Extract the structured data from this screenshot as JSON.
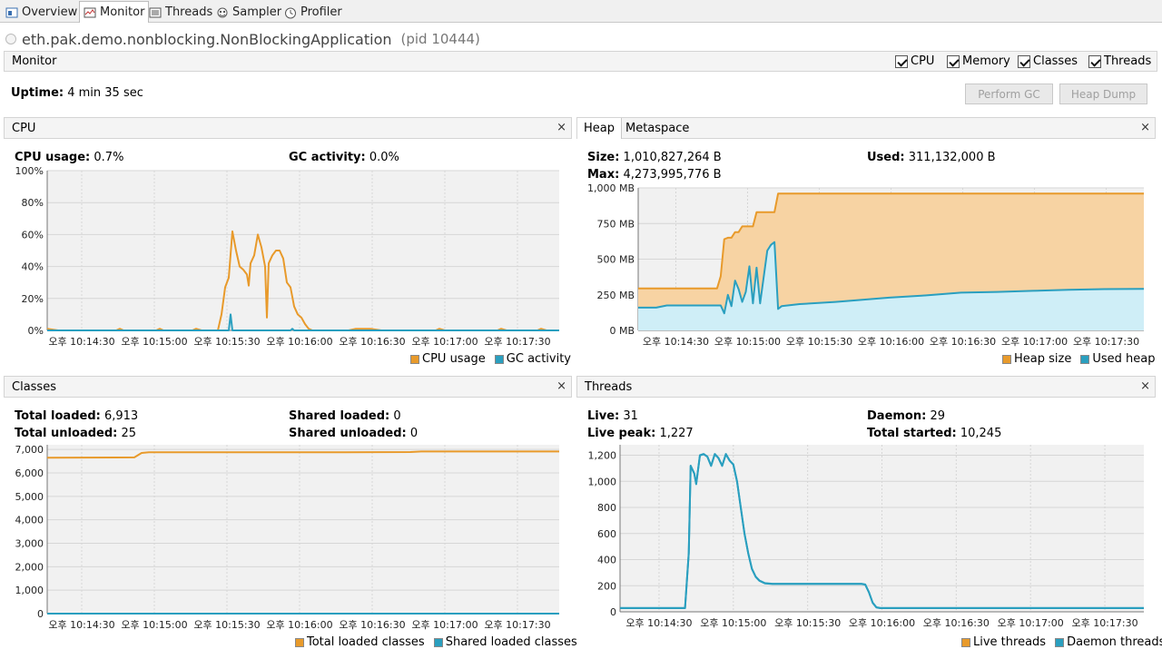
{
  "tabs": [
    {
      "label": "Overview",
      "icon": "overview-icon"
    },
    {
      "label": "Monitor",
      "icon": "monitor-icon",
      "active": true
    },
    {
      "label": "Threads",
      "icon": "threads-icon"
    },
    {
      "label": "Sampler",
      "icon": "sampler-icon"
    },
    {
      "label": "Profiler",
      "icon": "profiler-icon"
    }
  ],
  "app": {
    "name": "eth.pak.demo.nonblocking.NonBlockingApplication",
    "pid": "(pid 10444)"
  },
  "monitor_bar": {
    "label": "Monitor",
    "checkboxes": [
      {
        "label": "CPU",
        "checked": true
      },
      {
        "label": "Memory",
        "checked": true
      },
      {
        "label": "Classes",
        "checked": true
      },
      {
        "label": "Threads",
        "checked": true
      }
    ]
  },
  "uptime": {
    "label": "Uptime:",
    "value": "4 min 35 sec"
  },
  "buttons": {
    "perform_gc": "Perform GC",
    "heap_dump": "Heap Dump"
  },
  "cpu_panel": {
    "title": "CPU",
    "close": "×",
    "cpu_usage_label": "CPU usage:",
    "cpu_usage_value": "0.7%",
    "gc_label": "GC activity:",
    "gc_value": "0.0%",
    "legend": [
      "CPU usage",
      "GC activity"
    ]
  },
  "memory_panel": {
    "tabs": [
      "Heap",
      "Metaspace"
    ],
    "close": "×",
    "size_label": "Size:",
    "size_value": "1,010,827,264 B",
    "max_label": "Max:",
    "max_value": "4,273,995,776 B",
    "used_label": "Used:",
    "used_value": "311,132,000 B",
    "legend": [
      "Heap size",
      "Used heap"
    ]
  },
  "classes_panel": {
    "title": "Classes",
    "close": "×",
    "total_loaded_label": "Total loaded:",
    "total_loaded_value": "6,913",
    "total_unloaded_label": "Total unloaded:",
    "total_unloaded_value": "25",
    "shared_loaded_label": "Shared loaded:",
    "shared_loaded_value": "0",
    "shared_unloaded_label": "Shared unloaded:",
    "shared_unloaded_value": "0",
    "legend": [
      "Total loaded classes",
      "Shared loaded classes"
    ]
  },
  "threads_panel": {
    "title": "Threads",
    "close": "×",
    "live_label": "Live:",
    "live_value": "31",
    "live_peak_label": "Live peak:",
    "live_peak_value": "1,227",
    "daemon_label": "Daemon:",
    "daemon_value": "29",
    "total_started_label": "Total started:",
    "total_started_value": "10,245",
    "legend": [
      "Live threads",
      "Daemon threads"
    ]
  },
  "colors": {
    "orange": "#e89a2b",
    "teal": "#2a9fbf",
    "orange_fill": "#f7d3a3",
    "teal_fill": "#cfeef7",
    "grid": "#d6d6d6",
    "plot_bg": "#f1f1f1"
  },
  "chart_data": [
    {
      "type": "line",
      "title": "CPU",
      "x_ticks": [
        "오후 10:14:30",
        "오후 10:15:00",
        "오후 10:15:30",
        "오후 10:16:00",
        "오후 10:16:30",
        "오후 10:17:00",
        "오후 10:17:30"
      ],
      "y_ticks": [
        "100%",
        "80%",
        "60%",
        "40%",
        "20%",
        "0%"
      ],
      "ylim": [
        0,
        100
      ],
      "x_range_sec": [
        0,
        282
      ],
      "series": [
        {
          "name": "CPU usage",
          "color": "#e89a2b",
          "points": [
            [
              0,
              1
            ],
            [
              6,
              0
            ],
            [
              22,
              0
            ],
            [
              38,
              0
            ],
            [
              40,
              1
            ],
            [
              42,
              0
            ],
            [
              60,
              0
            ],
            [
              62,
              1
            ],
            [
              64,
              0
            ],
            [
              80,
              0
            ],
            [
              82,
              1
            ],
            [
              85,
              0
            ],
            [
              94,
              0
            ],
            [
              96,
              10
            ],
            [
              98,
              27
            ],
            [
              100,
              33
            ],
            [
              102,
              62
            ],
            [
              104,
              50
            ],
            [
              106,
              40
            ],
            [
              108,
              38
            ],
            [
              110,
              35
            ],
            [
              111,
              28
            ],
            [
              112,
              42
            ],
            [
              114,
              47
            ],
            [
              116,
              60
            ],
            [
              118,
              52
            ],
            [
              120,
              40
            ],
            [
              121,
              8
            ],
            [
              122,
              42
            ],
            [
              124,
              47
            ],
            [
              126,
              50
            ],
            [
              128,
              50
            ],
            [
              130,
              45
            ],
            [
              132,
              30
            ],
            [
              134,
              27
            ],
            [
              136,
              15
            ],
            [
              138,
              10
            ],
            [
              140,
              8
            ],
            [
              142,
              4
            ],
            [
              144,
              1
            ],
            [
              146,
              0
            ],
            [
              166,
              0
            ],
            [
              170,
              1
            ],
            [
              178,
              1
            ],
            [
              184,
              0
            ],
            [
              214,
              0
            ],
            [
              216,
              1
            ],
            [
              219,
              0
            ],
            [
              248,
              0
            ],
            [
              250,
              1
            ],
            [
              253,
              0
            ],
            [
              270,
              0
            ],
            [
              272,
              1
            ],
            [
              275,
              0
            ],
            [
              282,
              0
            ]
          ]
        },
        {
          "name": "GC activity",
          "color": "#2a9fbf",
          "points": [
            [
              0,
              0
            ],
            [
              100,
              0
            ],
            [
              101,
              10
            ],
            [
              102,
              0
            ],
            [
              134,
              0
            ],
            [
              135,
              1
            ],
            [
              136,
              0
            ],
            [
              282,
              0
            ]
          ]
        }
      ]
    },
    {
      "type": "area",
      "title": "Heap",
      "x_ticks": [
        "오후 10:14:30",
        "오후 10:15:00",
        "오후 10:15:30",
        "오후 10:16:00",
        "오후 10:16:30",
        "오후 10:17:00",
        "오후 10:17:30"
      ],
      "y_ticks": [
        "1,000 MB",
        "750 MB",
        "500 MB",
        "250 MB",
        "0 MB"
      ],
      "ylim": [
        0,
        1000
      ],
      "x_range_sec": [
        0,
        282
      ],
      "series": [
        {
          "name": "Heap size",
          "color": "#e89a2b",
          "points": [
            [
              0,
              295
            ],
            [
              44,
              295
            ],
            [
              46,
              380
            ],
            [
              48,
              640
            ],
            [
              50,
              650
            ],
            [
              52,
              650
            ],
            [
              54,
              690
            ],
            [
              56,
              690
            ],
            [
              58,
              730
            ],
            [
              60,
              730
            ],
            [
              64,
              730
            ],
            [
              66,
              830
            ],
            [
              68,
              830
            ],
            [
              76,
              830
            ],
            [
              78,
              960
            ],
            [
              80,
              960
            ],
            [
              282,
              960
            ]
          ]
        },
        {
          "name": "Used heap",
          "color": "#2a9fbf",
          "points": [
            [
              0,
              160
            ],
            [
              10,
              160
            ],
            [
              16,
              175
            ],
            [
              46,
              175
            ],
            [
              48,
              120
            ],
            [
              50,
              250
            ],
            [
              52,
              170
            ],
            [
              54,
              350
            ],
            [
              56,
              290
            ],
            [
              58,
              200
            ],
            [
              60,
              270
            ],
            [
              62,
              450
            ],
            [
              64,
              190
            ],
            [
              66,
              440
            ],
            [
              68,
              190
            ],
            [
              72,
              560
            ],
            [
              74,
              600
            ],
            [
              76,
              620
            ],
            [
              78,
              150
            ],
            [
              80,
              170
            ],
            [
              90,
              185
            ],
            [
              110,
              200
            ],
            [
              140,
              230
            ],
            [
              160,
              245
            ],
            [
              180,
              265
            ],
            [
              200,
              270
            ],
            [
              220,
              278
            ],
            [
              240,
              285
            ],
            [
              260,
              290
            ],
            [
              282,
              292
            ]
          ]
        }
      ]
    },
    {
      "type": "line",
      "title": "Classes",
      "x_ticks": [
        "오후 10:14:30",
        "오후 10:15:00",
        "오후 10:15:30",
        "오후 10:16:00",
        "오후 10:16:30",
        "오후 10:17:00",
        "오후 10:17:30"
      ],
      "y_ticks": [
        "7,000",
        "6,000",
        "5,000",
        "4,000",
        "3,000",
        "2,000",
        "1,000",
        "0"
      ],
      "ylim": [
        0,
        7200
      ],
      "x_range_sec": [
        0,
        282
      ],
      "series": [
        {
          "name": "Total loaded classes",
          "color": "#e89a2b",
          "points": [
            [
              0,
              6650
            ],
            [
              48,
              6660
            ],
            [
              52,
              6850
            ],
            [
              56,
              6880
            ],
            [
              80,
              6880
            ],
            [
              150,
              6880
            ],
            [
              200,
              6890
            ],
            [
              206,
              6913
            ],
            [
              282,
              6913
            ]
          ]
        },
        {
          "name": "Shared loaded classes",
          "color": "#2a9fbf",
          "points": [
            [
              0,
              0
            ],
            [
              282,
              0
            ]
          ]
        }
      ]
    },
    {
      "type": "line",
      "title": "Threads",
      "x_ticks": [
        "오후 10:14:30",
        "오후 10:15:00",
        "오후 10:15:30",
        "오후 10:16:00",
        "오후 10:16:30",
        "오후 10:17:00",
        "오후 10:17:30"
      ],
      "y_ticks": [
        "1,200",
        "1,000",
        "800",
        "600",
        "400",
        "200",
        "0"
      ],
      "ylim": [
        0,
        1280
      ],
      "x_range_sec": [
        0,
        282
      ],
      "series": [
        {
          "name": "Live threads",
          "color": "#2a9fbf",
          "points": [
            [
              0,
              30
            ],
            [
              35,
              30
            ],
            [
              37,
              450
            ],
            [
              38,
              1120
            ],
            [
              40,
              1060
            ],
            [
              41,
              980
            ],
            [
              43,
              1200
            ],
            [
              45,
              1210
            ],
            [
              47,
              1190
            ],
            [
              49,
              1120
            ],
            [
              51,
              1210
            ],
            [
              53,
              1180
            ],
            [
              55,
              1120
            ],
            [
              57,
              1210
            ],
            [
              59,
              1160
            ],
            [
              61,
              1130
            ],
            [
              63,
              1000
            ],
            [
              65,
              800
            ],
            [
              67,
              600
            ],
            [
              69,
              450
            ],
            [
              71,
              330
            ],
            [
              73,
              270
            ],
            [
              75,
              240
            ],
            [
              78,
              220
            ],
            [
              82,
              215
            ],
            [
              120,
              215
            ],
            [
              130,
              215
            ],
            [
              132,
              210
            ],
            [
              134,
              150
            ],
            [
              136,
              70
            ],
            [
              138,
              35
            ],
            [
              140,
              30
            ],
            [
              282,
              30
            ]
          ]
        },
        {
          "name": "Daemon threads",
          "color": "#2a9fbf",
          "points": [
            [
              0,
              28
            ],
            [
              35,
              28
            ],
            [
              37,
              448
            ],
            [
              38,
              1118
            ],
            [
              40,
              1058
            ],
            [
              41,
              978
            ],
            [
              43,
              1198
            ],
            [
              45,
              1208
            ],
            [
              47,
              1188
            ],
            [
              49,
              1118
            ],
            [
              51,
              1208
            ],
            [
              53,
              1178
            ],
            [
              55,
              1118
            ],
            [
              57,
              1208
            ],
            [
              59,
              1158
            ],
            [
              61,
              1128
            ],
            [
              63,
              998
            ],
            [
              65,
              798
            ],
            [
              67,
              598
            ],
            [
              69,
              448
            ],
            [
              71,
              328
            ],
            [
              73,
              268
            ],
            [
              75,
              238
            ],
            [
              78,
              218
            ],
            [
              82,
              213
            ],
            [
              120,
              213
            ],
            [
              130,
              213
            ],
            [
              132,
              208
            ],
            [
              134,
              148
            ],
            [
              136,
              68
            ],
            [
              138,
              33
            ],
            [
              140,
              28
            ],
            [
              282,
              28
            ]
          ]
        }
      ]
    }
  ]
}
